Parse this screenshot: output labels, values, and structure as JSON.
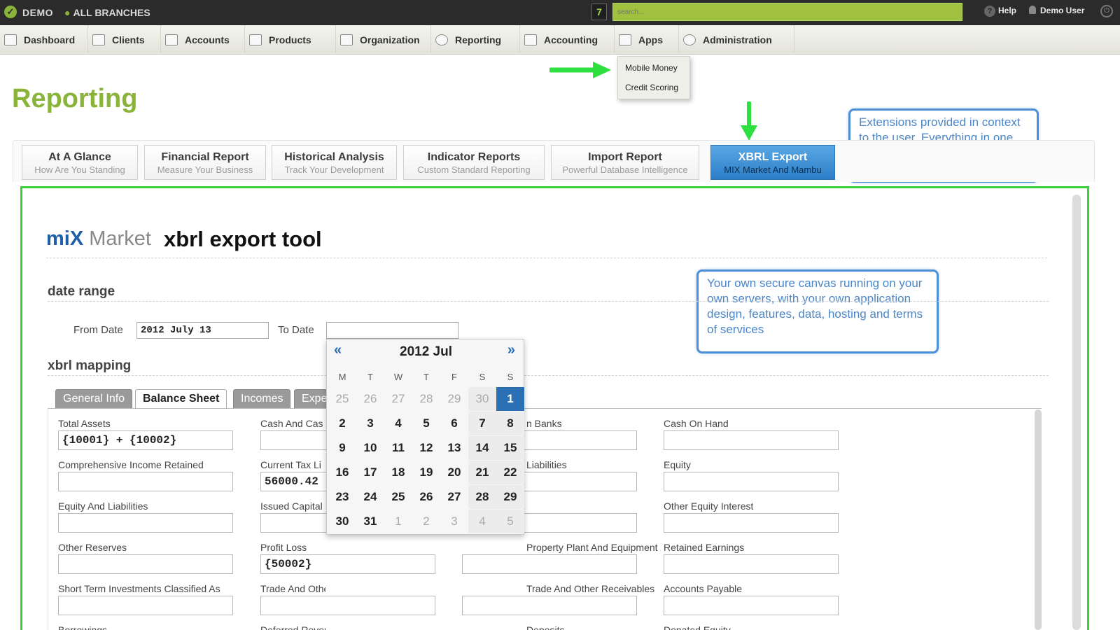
{
  "topbar": {
    "brand": "DEMO",
    "branches": "ALL BRANCHES",
    "notification_count": "7",
    "search_placeholder": "search...",
    "help": "Help",
    "user": "Demo User"
  },
  "nav": [
    {
      "label": "Dashboard",
      "icon": "home-icon"
    },
    {
      "label": "Clients",
      "icon": "clients-icon"
    },
    {
      "label": "Accounts",
      "icon": "accounts-icon"
    },
    {
      "label": "Products",
      "icon": "products-icon"
    },
    {
      "label": "Organization",
      "icon": "organization-icon"
    },
    {
      "label": "Reporting",
      "icon": "reporting-icon"
    },
    {
      "label": "Accounting",
      "icon": "accounting-icon"
    },
    {
      "label": "Apps",
      "icon": "apps-icon"
    },
    {
      "label": "Administration",
      "icon": "gear-icon"
    }
  ],
  "apps_menu": [
    "Mobile Money",
    "Credit Scoring"
  ],
  "page_title": "Reporting",
  "callouts": {
    "extensions": "Extensions provided in context to the user. Everything in one place, integrated and easy to use",
    "canvas": "Your own secure canvas running on your own servers, with your own application design, features, data, hosting and terms of services"
  },
  "report_tabs": [
    {
      "title": "At A Glance",
      "subtitle": "How Are You Standing"
    },
    {
      "title": "Financial Report",
      "subtitle": "Measure Your Business"
    },
    {
      "title": "Historical Analysis",
      "subtitle": "Track Your Development"
    },
    {
      "title": "Indicator Reports",
      "subtitle": "Custom Standard Reporting"
    },
    {
      "title": "Import Report",
      "subtitle": "Powerful Database Intelligence"
    },
    {
      "title": "XBRL Export",
      "subtitle": "MIX Market And Mambu"
    }
  ],
  "tool": {
    "logo_mix": "miX",
    "logo_market": "Market",
    "title": "xbrl export tool",
    "date_range_heading": "date range",
    "from_label": "From Date",
    "from_value": "2012 July 13",
    "to_label": "To Date",
    "to_value": "",
    "mapping_heading": "xbrl mapping"
  },
  "xbrl_tabs": [
    "General Info",
    "Balance Sheet",
    "Incomes",
    "Expe"
  ],
  "fields": [
    [
      {
        "label": "Total Assets",
        "value": "{10001} + {10002}"
      },
      {
        "label": "Cash And Cas",
        "value": ""
      },
      {
        "label": "n Banks",
        "value": ""
      },
      {
        "label": "Cash On Hand",
        "value": ""
      }
    ],
    [
      {
        "label": "Comprehensive Income Retained",
        "value": ""
      },
      {
        "label": "Current Tax Li",
        "value": "56000.42"
      },
      {
        "label": "Liabilities",
        "value": ""
      },
      {
        "label": "Equity",
        "value": ""
      }
    ],
    [
      {
        "label": "Equity And Liabilities",
        "value": ""
      },
      {
        "label": "Issued Capital",
        "value": ""
      },
      {
        "label": "",
        "value": ""
      },
      {
        "label": "Other Equity Interest",
        "value": ""
      }
    ],
    [
      {
        "label": "Other Reserves",
        "value": ""
      },
      {
        "label": "Profit Loss",
        "value": "{50002}"
      },
      {
        "label": "Property Plant And Equipment",
        "value": ""
      },
      {
        "label": "Retained Earnings",
        "value": ""
      }
    ],
    [
      {
        "label": "Short Term Investments Classified As",
        "value": ""
      },
      {
        "label": "Trade And Other Payables",
        "value": ""
      },
      {
        "label": "Trade And Other Receivables",
        "value": ""
      },
      {
        "label": "Accounts Payable",
        "value": ""
      }
    ],
    [
      {
        "label": "Borrowings",
        "value": ""
      },
      {
        "label": "Deferred Revenue",
        "value": ""
      },
      {
        "label": "Deposits",
        "value": ""
      },
      {
        "label": "Donated Equity",
        "value": ""
      }
    ]
  ],
  "calendar": {
    "prev": "«",
    "next": "»",
    "month": "2012 Jul",
    "weekdays": [
      "M",
      "T",
      "W",
      "T",
      "F",
      "S",
      "S"
    ],
    "weeks": [
      [
        {
          "d": "25",
          "o": true
        },
        {
          "d": "26",
          "o": true
        },
        {
          "d": "27",
          "o": true
        },
        {
          "d": "28",
          "o": true
        },
        {
          "d": "29",
          "o": true
        },
        {
          "d": "30",
          "o": true
        },
        {
          "d": "1",
          "s": true
        }
      ],
      [
        {
          "d": "2"
        },
        {
          "d": "3"
        },
        {
          "d": "4"
        },
        {
          "d": "5"
        },
        {
          "d": "6"
        },
        {
          "d": "7"
        },
        {
          "d": "8"
        }
      ],
      [
        {
          "d": "9"
        },
        {
          "d": "10"
        },
        {
          "d": "11"
        },
        {
          "d": "12"
        },
        {
          "d": "13"
        },
        {
          "d": "14"
        },
        {
          "d": "15"
        }
      ],
      [
        {
          "d": "16"
        },
        {
          "d": "17"
        },
        {
          "d": "18"
        },
        {
          "d": "19"
        },
        {
          "d": "20"
        },
        {
          "d": "21"
        },
        {
          "d": "22"
        }
      ],
      [
        {
          "d": "23"
        },
        {
          "d": "24"
        },
        {
          "d": "25"
        },
        {
          "d": "26"
        },
        {
          "d": "27"
        },
        {
          "d": "28"
        },
        {
          "d": "29"
        }
      ],
      [
        {
          "d": "30"
        },
        {
          "d": "31"
        },
        {
          "d": "1",
          "o": true
        },
        {
          "d": "2",
          "o": true
        },
        {
          "d": "3",
          "o": true
        },
        {
          "d": "4",
          "o": true
        },
        {
          "d": "5",
          "o": true
        }
      ]
    ]
  },
  "colors": {
    "accent": "#8ab33a",
    "highlight_frame": "#37d23c",
    "callout": "#4d8fd6",
    "active_tab": "#2b7ec7"
  }
}
